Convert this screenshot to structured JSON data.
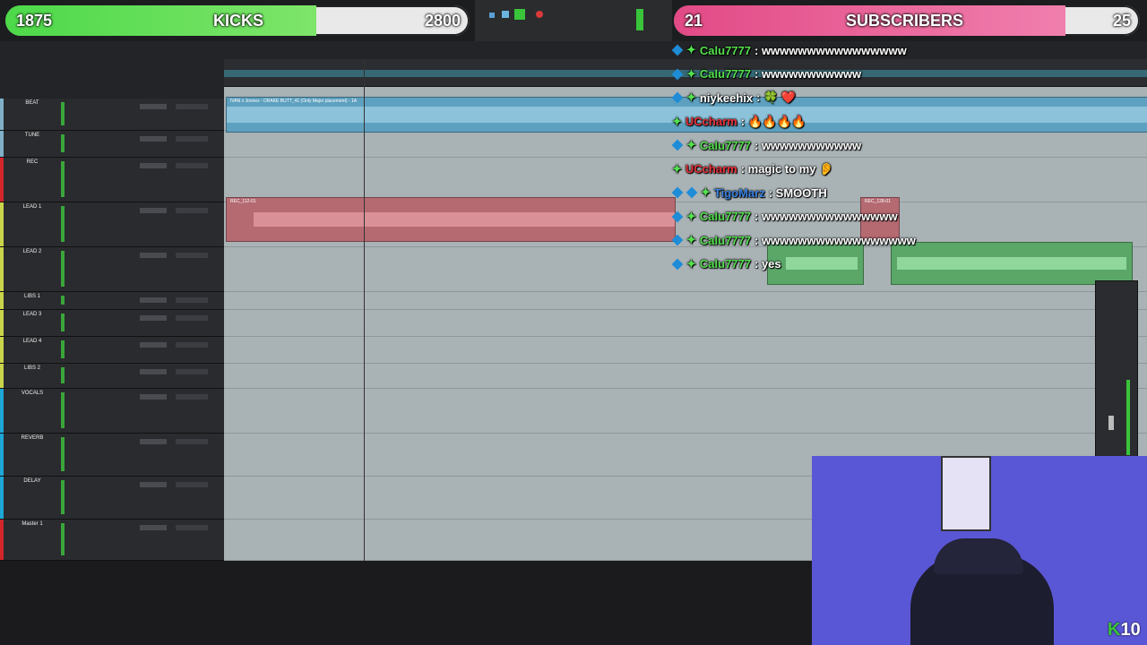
{
  "banner_left": {
    "count": "1875",
    "label": "KICKS",
    "goal_value": "2800",
    "fill": 0.67
  },
  "banner_right": {
    "count": "21",
    "label": "SUBSCRIBERS",
    "goal_value": "25",
    "fill": 0.84
  },
  "tracks": [
    {
      "name": "BEAT",
      "color": "#7fb0c8"
    },
    {
      "name": "TUNE",
      "color": "#7fb0c8"
    },
    {
      "name": "REC",
      "color": "#d2262a"
    },
    {
      "name": "LEAD 1",
      "color": "#c9d44a"
    },
    {
      "name": "LEAD 2",
      "color": "#c9d44a"
    },
    {
      "name": "LIBS 1",
      "color": "#c9d44a"
    },
    {
      "name": "LEAD 3",
      "color": "#c9d44a"
    },
    {
      "name": "LEAD 4",
      "color": "#c9d44a"
    },
    {
      "name": "LIBS 2",
      "color": "#c9d44a"
    },
    {
      "name": "VOCALS",
      "color": "#1ea6d6"
    },
    {
      "name": "REVERB",
      "color": "#1ea6d6"
    },
    {
      "name": "DELAY",
      "color": "#1ea6d6"
    },
    {
      "name": "Master 1",
      "color": "#d2262a"
    }
  ],
  "clips": {
    "beat_name": "IVAN x Joonez - DRAKE BUTT_41 (Only Major placement) - 1A",
    "rec_name": "REC_112-01",
    "rec2_name": "REC_128-01"
  },
  "chat": [
    {
      "badges": [
        "blue",
        "green"
      ],
      "user": "Calu7777",
      "user_color": "#55e04f",
      "text": ": wwwwwwwwwwwwwwww"
    },
    {
      "badges": [
        "blue",
        "green"
      ],
      "user": "Calu7777",
      "user_color": "#55e04f",
      "text": ": wwwwwwwwwww"
    },
    {
      "badges": [
        "blue",
        "green"
      ],
      "user": "niykeehix",
      "user_color": "#ffffff",
      "text": ": 🍀 ❤️"
    },
    {
      "badges": [
        "green"
      ],
      "user": "UCcharm",
      "user_color": "#e8313a",
      "text": ": 🔥🔥🔥🔥"
    },
    {
      "badges": [
        "blue",
        "green"
      ],
      "user": "Calu7777",
      "user_color": "#55e04f",
      "text": ": wwwwwwwwwww"
    },
    {
      "badges": [
        "green"
      ],
      "user": "UCcharm",
      "user_color": "#e8313a",
      "text": ": magic to my 👂"
    },
    {
      "badges": [
        "blue",
        "blue",
        "green"
      ],
      "user": "TigoMarz",
      "user_color": "#3a82e0",
      "text": ": SMOOTH"
    },
    {
      "badges": [
        "blue",
        "green"
      ],
      "user": "Calu7777",
      "user_color": "#55e04f",
      "text": ": wwwwwwwwwwwwwww"
    },
    {
      "badges": [
        "blue",
        "green"
      ],
      "user": "Calu7777",
      "user_color": "#55e04f",
      "text": ": wwwwwwwwwwwwwwwww"
    },
    {
      "badges": [
        "blue",
        "green"
      ],
      "user": "Calu7777",
      "user_color": "#55e04f",
      "text": ": yes"
    }
  ],
  "kick_tag": "10"
}
